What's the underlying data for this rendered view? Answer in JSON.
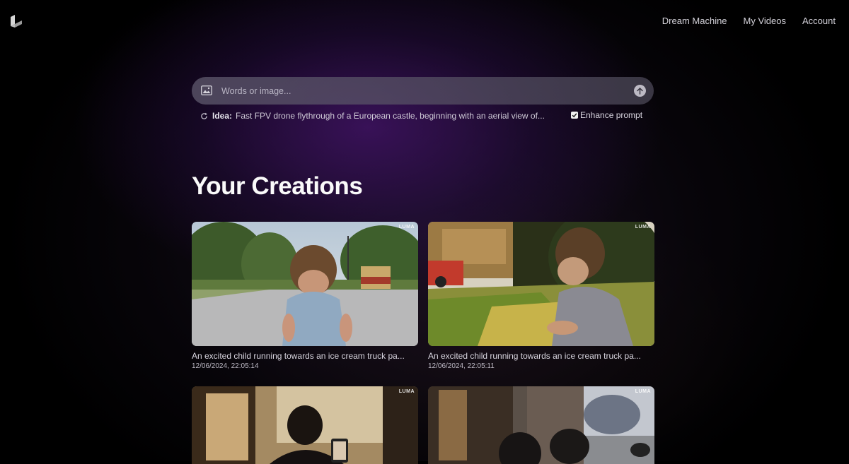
{
  "nav": {
    "items": [
      "Dream Machine",
      "My Videos",
      "Account"
    ]
  },
  "search": {
    "placeholder": "Words or image..."
  },
  "idea": {
    "label": "Idea:",
    "text": "Fast FPV drone flythrough of a European castle, beginning with an aerial view of..."
  },
  "enhance": {
    "label": "Enhance prompt",
    "checked": true
  },
  "section": {
    "title": "Your Creations"
  },
  "creations": [
    {
      "caption": "An excited child running towards an ice cream truck pa...",
      "date": "12/06/2024, 22:05:14",
      "watermark": "LUMA"
    },
    {
      "caption": "An excited child running towards an ice cream truck pa...",
      "date": "12/06/2024, 22:05:11",
      "watermark": "LUMA"
    },
    {
      "caption": "",
      "date": "",
      "watermark": "LUMA"
    },
    {
      "caption": "",
      "date": "",
      "watermark": "LUMA"
    }
  ],
  "colors": {
    "background": "#000000",
    "accent_glow": "#46146e",
    "search_bg": "#5f5a6e"
  }
}
